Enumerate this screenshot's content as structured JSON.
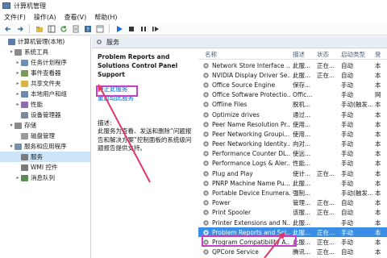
{
  "window": {
    "title": "计算机管理"
  },
  "menu": {
    "items": [
      "文件(F)",
      "操作(A)",
      "查看(V)",
      "帮助(H)"
    ]
  },
  "tree": {
    "items": [
      {
        "label": "计算机管理(本地)",
        "indent": 0,
        "expander": "",
        "icon": "computer-icon",
        "color": "#5b7fa8"
      },
      {
        "label": "系统工具",
        "indent": 1,
        "expander": "v",
        "icon": "tools-icon",
        "color": "#8a8a8a"
      },
      {
        "label": "任务计划程序",
        "indent": 2,
        "expander": ">",
        "icon": "clock-icon",
        "color": "#6e8fb3"
      },
      {
        "label": "事件查看器",
        "indent": 2,
        "expander": ">",
        "icon": "event-viewer-icon",
        "color": "#7b9a5a"
      },
      {
        "label": "共享文件夹",
        "indent": 2,
        "expander": ">",
        "icon": "folder-icon",
        "color": "#d8b44a"
      },
      {
        "label": "本地用户和组",
        "indent": 2,
        "expander": ">",
        "icon": "users-icon",
        "color": "#6c89b0"
      },
      {
        "label": "性能",
        "indent": 2,
        "expander": ">",
        "icon": "performance-icon",
        "color": "#8c6bb1"
      },
      {
        "label": "设备管理器",
        "indent": 2,
        "expander": "",
        "icon": "device-manager-icon",
        "color": "#7a8a9a"
      },
      {
        "label": "存储",
        "indent": 1,
        "expander": "v",
        "icon": "storage-icon",
        "color": "#8a8a8a"
      },
      {
        "label": "磁盘管理",
        "indent": 2,
        "expander": "",
        "icon": "disk-icon",
        "color": "#9a9a9a"
      },
      {
        "label": "服务和应用程序",
        "indent": 1,
        "expander": "v",
        "icon": "services-apps-icon",
        "color": "#7a8fa8"
      },
      {
        "label": "服务",
        "indent": 2,
        "expander": "",
        "icon": "gear-icon",
        "color": "#7a7a7a",
        "selected": true
      },
      {
        "label": "WMI 控件",
        "indent": 2,
        "expander": "",
        "icon": "wmi-icon",
        "color": "#7a7a7a"
      },
      {
        "label": "消息队列",
        "indent": 2,
        "expander": ">",
        "icon": "message-queue-icon",
        "color": "#5b8a5b"
      }
    ]
  },
  "panel": {
    "header": "服务",
    "service_title": "Problem Reports and Solutions Control Panel Support",
    "stop_link": "停止此服务",
    "restart_link": "重启动此服务",
    "desc_label": "描述:",
    "desc_text": "此服务为查看、发送和删除“问题报告和解决方案”控制面板的系统级问题报告提供支持。"
  },
  "columns": {
    "name": "名称",
    "desc": "描述",
    "status": "状态",
    "startup": "启动类型",
    "logon": "登"
  },
  "services": [
    {
      "name": "Network Store Interface ...",
      "desc": "此服...",
      "status": "正在...",
      "startup": "自动",
      "logon": "本"
    },
    {
      "name": "NVIDIA Display Driver Se...",
      "desc": "此服...",
      "status": "正在...",
      "startup": "自动",
      "logon": "本"
    },
    {
      "name": "Office  Source Engine",
      "desc": "保存...",
      "status": "",
      "startup": "手动",
      "logon": "本"
    },
    {
      "name": "Office Software Protectio...",
      "desc": "Offic...",
      "status": "",
      "startup": "手动",
      "logon": "网"
    },
    {
      "name": "Offline Files",
      "desc": "脱机...",
      "status": "",
      "startup": "手动(触发...",
      "logon": "本"
    },
    {
      "name": "Optimize drives",
      "desc": "通过...",
      "status": "",
      "startup": "手动",
      "logon": "本"
    },
    {
      "name": "Peer Name Resolution Pr...",
      "desc": "使用...",
      "status": "",
      "startup": "手动",
      "logon": "本"
    },
    {
      "name": "Peer Networking Groupi...",
      "desc": "使用...",
      "status": "",
      "startup": "手动",
      "logon": "本"
    },
    {
      "name": "Peer Networking Identity...",
      "desc": "向对...",
      "status": "",
      "startup": "手动",
      "logon": "本"
    },
    {
      "name": "Performance Counter DL...",
      "desc": "使远...",
      "status": "",
      "startup": "手动",
      "logon": "本"
    },
    {
      "name": "Performance Logs & Aler...",
      "desc": "性能...",
      "status": "",
      "startup": "手动",
      "logon": "本"
    },
    {
      "name": "Plug and Play",
      "desc": "使计...",
      "status": "正在...",
      "startup": "手动",
      "logon": "本"
    },
    {
      "name": "PNRP Machine Name Pu...",
      "desc": "此服...",
      "status": "",
      "startup": "手动",
      "logon": "本"
    },
    {
      "name": "Portable Device Enumera...",
      "desc": "强制...",
      "status": "",
      "startup": "手动(触发...",
      "logon": "本"
    },
    {
      "name": "Power",
      "desc": "管理...",
      "status": "正在...",
      "startup": "自动",
      "logon": "本"
    },
    {
      "name": "Print Spooler",
      "desc": "该服...",
      "status": "正在...",
      "startup": "自动",
      "logon": "本"
    },
    {
      "name": "Printer Extensions and N...",
      "desc": "此服...",
      "status": "",
      "startup": "手动",
      "logon": "本"
    },
    {
      "name": "Problem Reports and Sol...",
      "desc": "此服...",
      "status": "正在...",
      "startup": "手动",
      "logon": "本",
      "selected": true
    },
    {
      "name": "Program Compatibility A...",
      "desc": "此服...",
      "status": "正在...",
      "startup": "手动",
      "logon": "本"
    },
    {
      "name": "QPCore Service",
      "desc": "腾讯...",
      "status": "正在...",
      "startup": "自动",
      "logon": "本"
    }
  ],
  "colors": {
    "highlight_box": "#c93fc9",
    "selection": "#3a8ee6",
    "link": "#0066cc",
    "arrow": "#e0366a"
  }
}
